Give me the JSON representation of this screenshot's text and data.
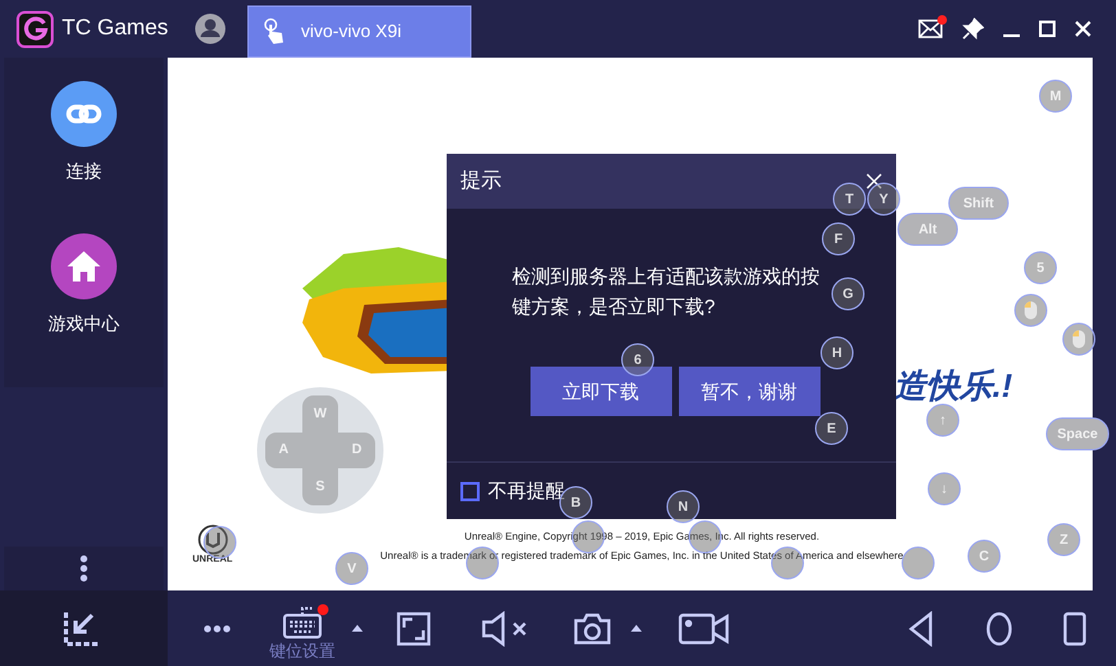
{
  "title_bar": {
    "app_name": "TC Games",
    "tabs": [
      {
        "label": "vivo-vivo X9i",
        "selected": true
      }
    ],
    "mail_unread": true
  },
  "sidebar": {
    "items": [
      {
        "label": "连接",
        "kind": "connect"
      },
      {
        "label": "游戏中心",
        "kind": "games"
      }
    ]
  },
  "screen": {
    "slogan": "造快乐.!",
    "logo_text": "UNREAL",
    "footer": [
      "Unreal® Engine, Copyright 1998 – 2019, Epic Games, Inc.  All rights reserved.",
      "Unreal® is a trademark or registered trademark of Epic Games, Inc. in the United States of America and elsewhere"
    ],
    "dpad": [
      "W",
      "A",
      "D",
      "S"
    ],
    "keys": [
      {
        "kind": "round",
        "label": "M"
      },
      {
        "kind": "wide",
        "label": "Shift"
      },
      {
        "kind": "wide",
        "label": "Alt"
      },
      {
        "kind": "round",
        "label": "T"
      },
      {
        "kind": "round",
        "label": "Y"
      },
      {
        "kind": "round",
        "label": "F"
      },
      {
        "kind": "round",
        "label": "G"
      },
      {
        "kind": "round",
        "label": "H"
      },
      {
        "kind": "round",
        "label": "E"
      },
      {
        "kind": "round",
        "label": "6"
      },
      {
        "kind": "round",
        "label": "N"
      },
      {
        "kind": "round",
        "label": "B"
      },
      {
        "kind": "round",
        "label": "5"
      },
      {
        "kind": "mouse"
      },
      {
        "kind": "mouse"
      },
      {
        "kind": "round",
        "label": "↑"
      },
      {
        "kind": "wide",
        "label": "Space"
      },
      {
        "kind": "round",
        "label": "↓"
      },
      {
        "kind": "round",
        "label": "Z"
      },
      {
        "kind": "round",
        "label": "C"
      },
      {
        "kind": "round",
        "label": "V"
      },
      {
        "kind": "blank"
      },
      {
        "kind": "blank"
      },
      {
        "kind": "blank"
      },
      {
        "kind": "blank"
      },
      {
        "kind": "blank"
      },
      {
        "kind": "blank"
      }
    ]
  },
  "dialog": {
    "title": "提示",
    "message": "检测到服务器上有适配该款游戏的按键方案，是否立即下载?",
    "buttons": [
      "立即下载",
      "暂不，谢谢"
    ],
    "checkbox": {
      "label": "不再提醒",
      "checked": false
    }
  },
  "toolbar": {
    "keymap_label": "键位设置",
    "keymap_badge": true
  }
}
